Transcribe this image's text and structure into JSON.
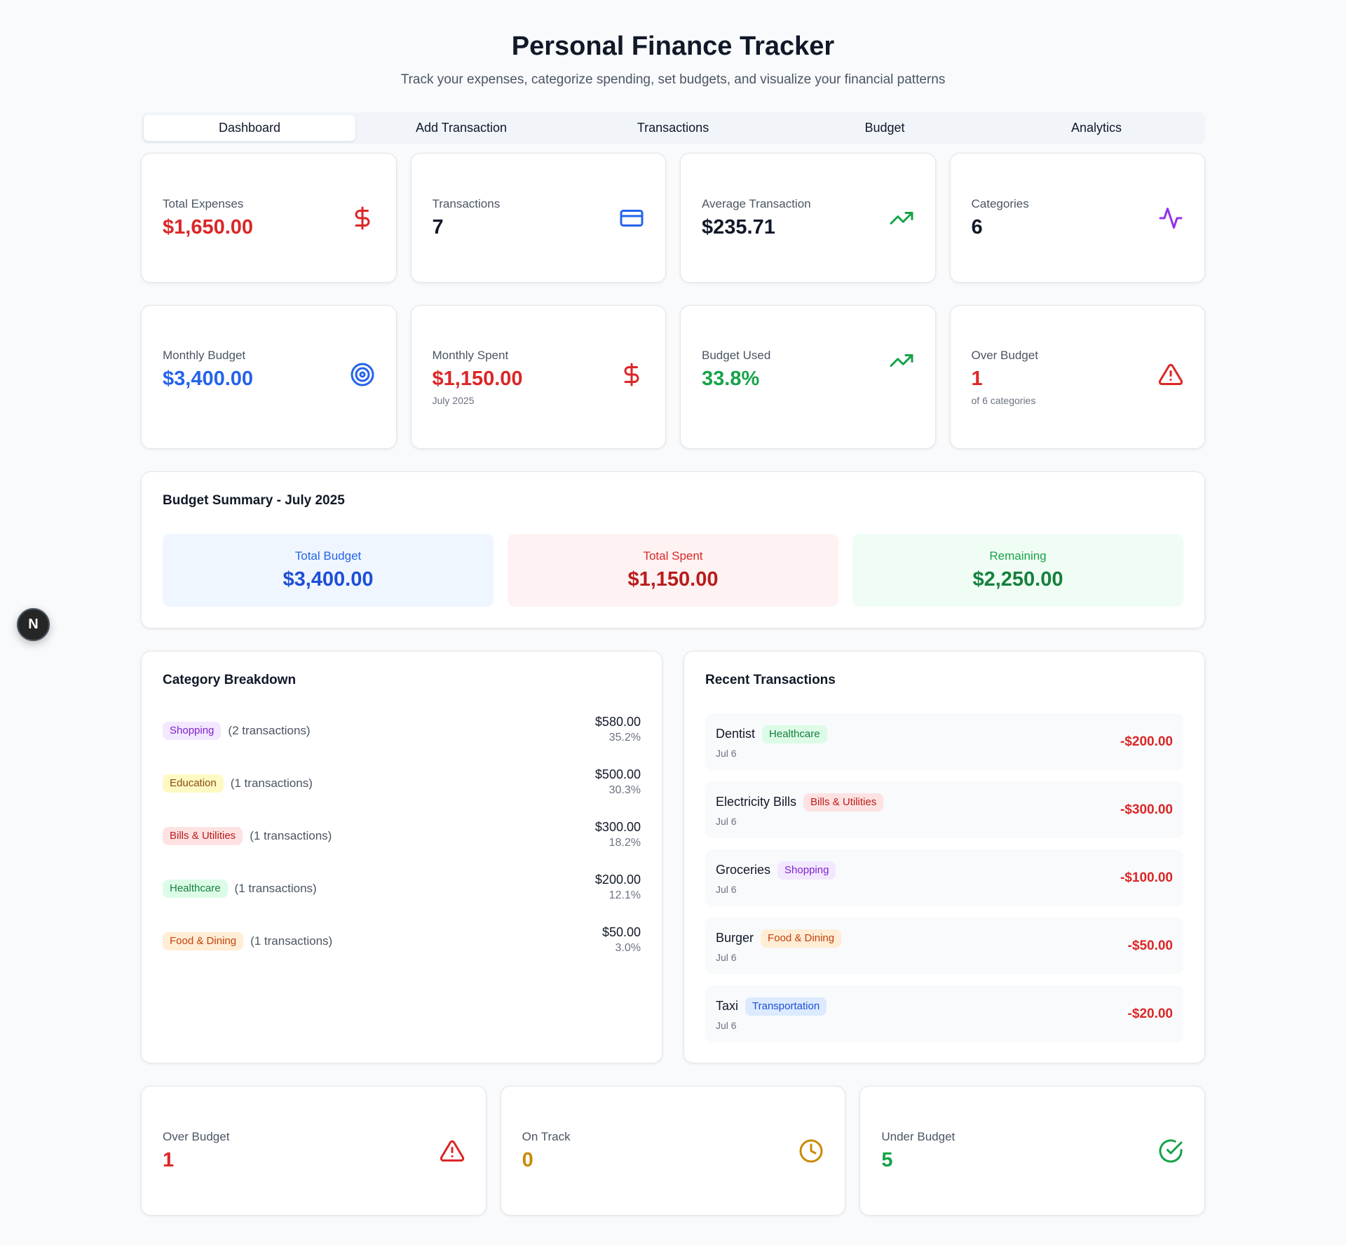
{
  "header": {
    "title": "Personal Finance Tracker",
    "subtitle": "Track your expenses, categorize spending, set budgets, and visualize your financial patterns"
  },
  "tabs": [
    {
      "label": "Dashboard",
      "active": true
    },
    {
      "label": "Add Transaction",
      "active": false
    },
    {
      "label": "Transactions",
      "active": false
    },
    {
      "label": "Budget",
      "active": false
    },
    {
      "label": "Analytics",
      "active": false
    }
  ],
  "stats_row1": [
    {
      "label": "Total Expenses",
      "value": "$1,650.00",
      "color": "#dc2626",
      "icon": "dollar-icon"
    },
    {
      "label": "Transactions",
      "value": "7",
      "color": "#111827",
      "icon": "credit-card-icon"
    },
    {
      "label": "Average Transaction",
      "value": "$235.71",
      "color": "#111827",
      "icon": "trending-up-icon"
    },
    {
      "label": "Categories",
      "value": "6",
      "color": "#111827",
      "icon": "activity-icon"
    }
  ],
  "stats_row2": [
    {
      "label": "Monthly Budget",
      "value": "$3,400.00",
      "color": "#2563eb",
      "icon": "target-icon"
    },
    {
      "label": "Monthly Spent",
      "value": "$1,150.00",
      "sub": "July 2025",
      "color": "#dc2626",
      "icon": "dollar-icon"
    },
    {
      "label": "Budget Used",
      "value": "33.8%",
      "color": "#16a34a",
      "icon": "trending-up-icon"
    },
    {
      "label": "Over Budget",
      "value": "1",
      "sub": "of 6 categories",
      "color": "#dc2626",
      "icon": "alert-triangle-icon"
    }
  ],
  "budget_summary": {
    "title": "Budget Summary - July 2025",
    "total_budget_label": "Total Budget",
    "total_budget_value": "$3,400.00",
    "total_spent_label": "Total Spent",
    "total_spent_value": "$1,150.00",
    "remaining_label": "Remaining",
    "remaining_value": "$2,250.00"
  },
  "category_breakdown": {
    "title": "Category Breakdown",
    "items": [
      {
        "category": "Shopping",
        "count": "(2 transactions)",
        "amount": "$580.00",
        "percent": "35.2%"
      },
      {
        "category": "Education",
        "count": "(1 transactions)",
        "amount": "$500.00",
        "percent": "30.3%"
      },
      {
        "category": "Bills & Utilities",
        "count": "(1 transactions)",
        "amount": "$300.00",
        "percent": "18.2%"
      },
      {
        "category": "Healthcare",
        "count": "(1 transactions)",
        "amount": "$200.00",
        "percent": "12.1%"
      },
      {
        "category": "Food & Dining",
        "count": "(1 transactions)",
        "amount": "$50.00",
        "percent": "3.0%"
      }
    ]
  },
  "recent_transactions": {
    "title": "Recent Transactions",
    "items": [
      {
        "name": "Dentist",
        "category": "Healthcare",
        "date": "Jul 6",
        "amount": "-$200.00"
      },
      {
        "name": "Electricity Bills",
        "category": "Bills & Utilities",
        "date": "Jul 6",
        "amount": "-$300.00"
      },
      {
        "name": "Groceries",
        "category": "Shopping",
        "date": "Jul 6",
        "amount": "-$100.00"
      },
      {
        "name": "Burger",
        "category": "Food & Dining",
        "date": "Jul 6",
        "amount": "-$50.00"
      },
      {
        "name": "Taxi",
        "category": "Transportation",
        "date": "Jul 6",
        "amount": "-$20.00"
      }
    ]
  },
  "status_row": [
    {
      "label": "Over Budget",
      "value": "1",
      "color": "#dc2626",
      "icon": "alert-triangle-icon"
    },
    {
      "label": "On Track",
      "value": "0",
      "color": "#ca8a04",
      "icon": "clock-icon"
    },
    {
      "label": "Under Budget",
      "value": "5",
      "color": "#16a34a",
      "icon": "check-circle-icon"
    }
  ],
  "fab": {
    "label": "N"
  }
}
